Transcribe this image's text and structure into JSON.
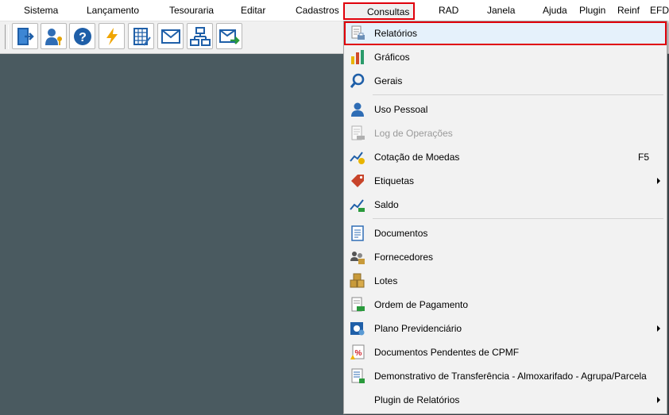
{
  "menubar": {
    "items": [
      {
        "id": "sistema",
        "label": "Sistema"
      },
      {
        "id": "lancamento",
        "label": "Lançamento"
      },
      {
        "id": "tesouraria",
        "label": "Tesouraria"
      },
      {
        "id": "editar",
        "label": "Editar"
      },
      {
        "id": "cadastros",
        "label": "Cadastros"
      },
      {
        "id": "consultas",
        "label": "Consultas"
      },
      {
        "id": "rad",
        "label": "RAD"
      },
      {
        "id": "janela",
        "label": "Janela"
      },
      {
        "id": "ajuda",
        "label": "Ajuda"
      },
      {
        "id": "plugin",
        "label": "Plugin"
      },
      {
        "id": "reinf",
        "label": "Reinf"
      },
      {
        "id": "efd",
        "label": "EFD"
      }
    ]
  },
  "toolbar": {
    "buttons": [
      {
        "icon": "exit-door-icon"
      },
      {
        "icon": "user-key-icon"
      },
      {
        "icon": "help-icon"
      },
      {
        "icon": "lightning-icon"
      },
      {
        "icon": "calculator-building-icon"
      },
      {
        "icon": "envelope-icon"
      },
      {
        "icon": "network-diagram-icon"
      },
      {
        "icon": "mail-send-icon"
      }
    ]
  },
  "consultas_menu": {
    "items": [
      {
        "label": "Relatórios",
        "icon": "report-printer-icon",
        "highlighted": true
      },
      {
        "label": "Gráficos",
        "icon": "bar-chart-icon"
      },
      {
        "label": "Gerais",
        "icon": "magnifier-icon"
      },
      {
        "label": "Uso Pessoal",
        "icon": "person-icon"
      },
      {
        "label": "Log de Operações",
        "icon": "log-file-icon",
        "disabled": true
      },
      {
        "label": "Cotação de Moedas",
        "icon": "currency-chart-icon",
        "shortcut": "F5"
      },
      {
        "label": "Etiquetas",
        "icon": "price-tag-icon",
        "submenu": true
      },
      {
        "label": "Saldo",
        "icon": "balance-chart-icon"
      },
      {
        "label": "Documentos",
        "icon": "document-icon"
      },
      {
        "label": "Fornecedores",
        "icon": "suppliers-icon"
      },
      {
        "label": "Lotes",
        "icon": "boxes-icon"
      },
      {
        "label": "Ordem de Pagamento",
        "icon": "payment-order-icon"
      },
      {
        "label": "Plano Previdenciário",
        "icon": "pension-plan-icon",
        "submenu": true
      },
      {
        "label": "Documentos Pendentes de CPMF",
        "icon": "pending-cpmf-icon"
      },
      {
        "label": "Demonstrativo de Transferência - Almoxarifado - Agrupa/Parcela",
        "icon": "transfer-statement-icon"
      },
      {
        "label": "Plugin de Relatórios",
        "icon": "",
        "submenu": true
      }
    ]
  },
  "colors": {
    "highlight_border": "#e0000a",
    "workspace": "#4a5a60",
    "menu_bg": "#f2f2f2"
  }
}
